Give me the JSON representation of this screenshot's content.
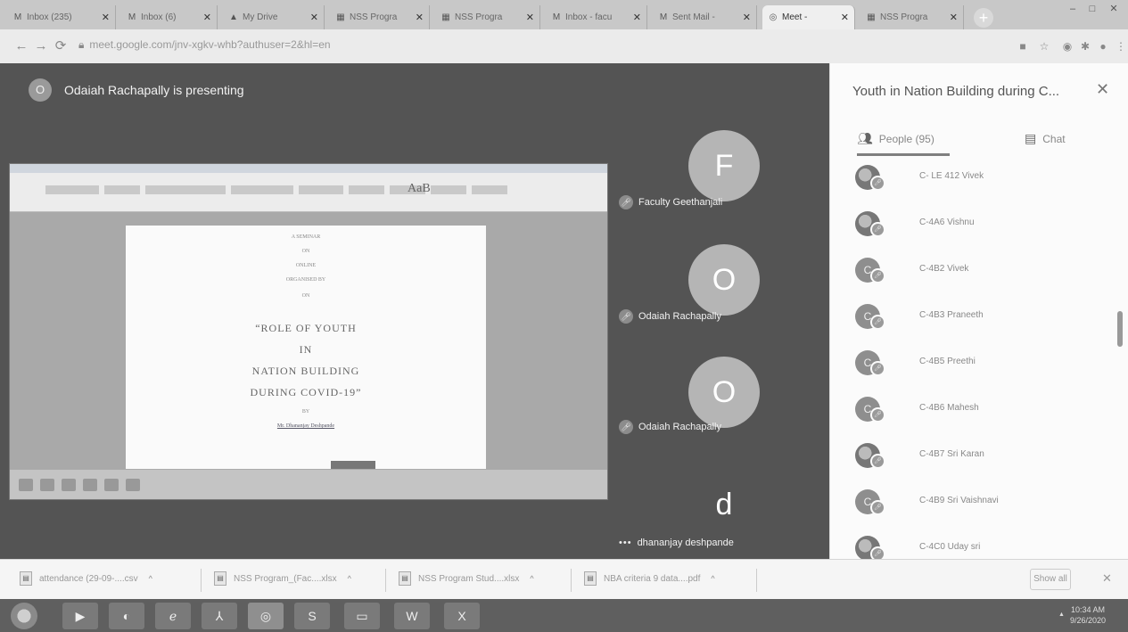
{
  "browser": {
    "tabs": [
      {
        "icon": "gmail-icon",
        "glyph": "M",
        "title": "Inbox (235)"
      },
      {
        "icon": "gmail-icon",
        "glyph": "M",
        "title": "Inbox (6)"
      },
      {
        "icon": "drive-icon",
        "glyph": "▲",
        "title": "My Drive"
      },
      {
        "icon": "sheets-icon",
        "glyph": "▦",
        "title": "NSS Progra"
      },
      {
        "icon": "sheets-icon",
        "glyph": "▦",
        "title": "NSS Progra"
      },
      {
        "icon": "gmail-icon",
        "glyph": "M",
        "title": "Inbox - facu"
      },
      {
        "icon": "gmail-icon",
        "glyph": "M",
        "title": "Sent Mail -"
      },
      {
        "icon": "meet-icon",
        "glyph": "◎",
        "title": "Meet -"
      },
      {
        "icon": "sheets-icon",
        "glyph": "▦",
        "title": "NSS Progra"
      }
    ],
    "url": "meet.google.com/jnv-xgkv-whb?authuser=2&hl=en"
  },
  "meet": {
    "presenter_initial": "O",
    "presenter_text": "Odaiah Rachapally is presenting",
    "document": {
      "lines_small": [
        "A SEMINAR",
        "ON",
        "ONLINE",
        "ORGANISED BY",
        "ON"
      ],
      "lines_big": [
        "“ROLE OF YOUTH",
        "IN",
        "NATION BUILDING",
        "DURING COVID-19”"
      ],
      "by": "BY",
      "author": "Mr. Dhananjay Deshpande"
    },
    "tiles": [
      {
        "initial": "F",
        "name": "Faculty Geethanjali"
      },
      {
        "initial": "O",
        "name": "Odaiah Rachapally"
      },
      {
        "initial": "O",
        "name": "Odaiah Rachapally"
      },
      {
        "initial": "d",
        "name": "dhananjay deshpande"
      }
    ]
  },
  "panel": {
    "title": "Youth in Nation Building during C...",
    "people_tab": "People (95)",
    "chat_tab": "Chat",
    "people": [
      {
        "initial": "",
        "name": "C- LE 412 Vivek",
        "photo": true
      },
      {
        "initial": "",
        "name": "C-4A6 Vishnu",
        "photo": true
      },
      {
        "initial": "C",
        "name": "C-4B2 Vivek",
        "photo": false
      },
      {
        "initial": "C",
        "name": "C-4B3 Praneeth",
        "photo": false
      },
      {
        "initial": "C",
        "name": "C-4B5 Preethi",
        "photo": false
      },
      {
        "initial": "C",
        "name": "C-4B6 Mahesh",
        "photo": false
      },
      {
        "initial": "",
        "name": "C-4B7 Sri Karan",
        "photo": true
      },
      {
        "initial": "C",
        "name": "C-4B9 Sri Vaishnavi",
        "photo": false
      },
      {
        "initial": "",
        "name": "C-4C0 Uday sri",
        "photo": true
      }
    ]
  },
  "downloads": {
    "items": [
      {
        "name": "attendance (29-09-....csv"
      },
      {
        "name": "NSS Program_(Fac....xlsx"
      },
      {
        "name": "NSS Program Stud....xlsx"
      },
      {
        "name": "NBA criteria 9 data....pdf"
      }
    ],
    "show_all": "Show all"
  },
  "os": {
    "time": "10:34 AM",
    "date": "9/26/2020"
  }
}
